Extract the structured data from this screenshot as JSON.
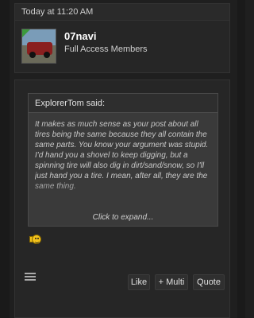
{
  "post": {
    "date": "Today at 11:20 AM",
    "user": {
      "name": "07navi",
      "title": "Full Access Members"
    },
    "quote": {
      "author": "ExplorerTom said:",
      "text": "It makes as much sense as your post about all tires being the same because they all contain the same parts. You know your argument was stupid. I'd hand you a shovel to keep digging, but a spinning tire will also dig in dirt/sand/snow, so I'll just hand you a tire. I mean, after all, they are the same thing.",
      "expand_label": "Click to expand..."
    },
    "actions": {
      "like": "Like",
      "multi": "+ Multi",
      "quote": "Quote"
    }
  }
}
